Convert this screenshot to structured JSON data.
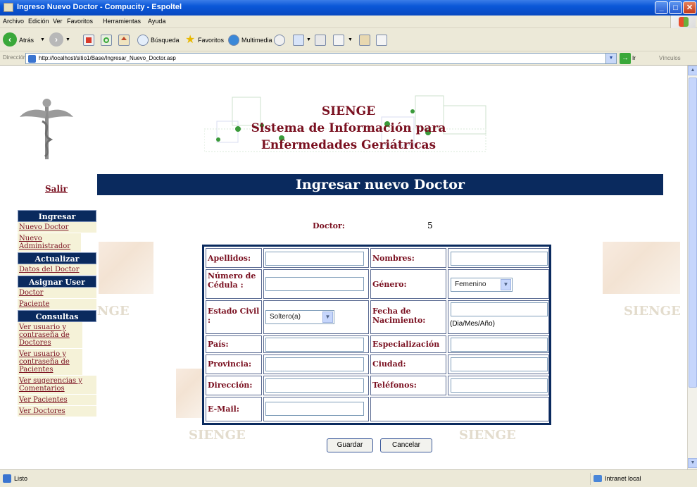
{
  "window": {
    "title": "Ingreso Nuevo Doctor - Compucity - Espoltel"
  },
  "menu": [
    "Archivo",
    "Edición",
    "Ver",
    "Favoritos",
    "Herramientas",
    "Ayuda"
  ],
  "toolbar": {
    "back": "Atrás",
    "search": "Búsqueda",
    "favorites": "Favoritos",
    "multimedia": "Multimedia"
  },
  "address": {
    "label": "Dirección",
    "url": "http://localhost/sitio1/Base/Ingresar_Nuevo_Doctor.asp",
    "go": "Ir",
    "links": "Vínculos"
  },
  "banner": {
    "line1": "SIENGE",
    "line2": "Sistema de Información para",
    "line3": "Enfermedades Geriátricas"
  },
  "page": {
    "salir": "Salir",
    "heading": "Ingresar nuevo Doctor",
    "doctor_label": "Doctor:",
    "doctor_value": "5"
  },
  "sidebar": {
    "ingresar": "Ingresar",
    "nuevo_doctor": "Nuevo Doctor",
    "nuevo_admin": "Nuevo Administrador",
    "actualizar": "Actualizar",
    "datos_doctor": "Datos del Doctor",
    "asignar": "Asignar User",
    "doctor": "Doctor",
    "paciente": "Paciente",
    "consultas": "Consultas",
    "ver_usr_doc": "Ver usuario y contraseña de Doctores",
    "ver_usr_pac": "Ver usuario y contraseña de Pacientes",
    "ver_sug": "Ver sugerencias y Comentarios",
    "ver_pac": "Ver Pacientes",
    "ver_doc": "Ver Doctores"
  },
  "form": {
    "apellidos": "Apellidos:",
    "nombres": "Nombres:",
    "cedula": "Número de Cédula :",
    "genero": "Género:",
    "genero_value": "Femenino",
    "estado_civil": "Estado Civil :",
    "estado_civil_value": "Soltero(a)",
    "fecha_nac": "Fecha de Nacimiento:",
    "fecha_hint": "(Dia/Mes/Año)",
    "pais": "País:",
    "especializacion": "Especialización",
    "provincia": "Provincia:",
    "ciudad": "Ciudad:",
    "direccion": "Dirección:",
    "telefonos": "Teléfonos:",
    "email": "E-Mail:"
  },
  "buttons": {
    "guardar": "Guardar",
    "cancelar": "Cancelar"
  },
  "status": {
    "text": "Listo",
    "zone": "Intranet local"
  },
  "watermark": "SIENGE",
  "colors": {
    "navy": "#0a2a5e",
    "maroon": "#7a1020",
    "link_bg": "#f5f2d8"
  }
}
